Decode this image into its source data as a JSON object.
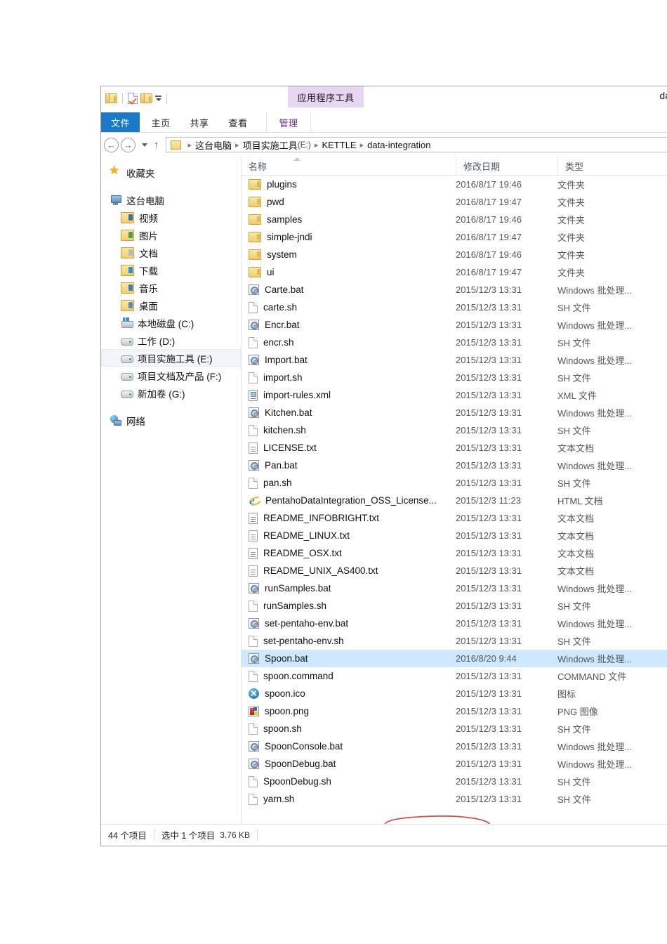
{
  "window": {
    "title": "da",
    "contextual_tab_header": "应用程序工具"
  },
  "quick_access": {
    "folder_icon": "folder-icon",
    "properties_icon": "page-check-icon",
    "new_folder_icon": "new-folder-icon",
    "customize_icon": "chevron-down-icon"
  },
  "ribbon": {
    "tabs": [
      {
        "id": "file",
        "label": "文件"
      },
      {
        "id": "home",
        "label": "主页"
      },
      {
        "id": "share",
        "label": "共享"
      },
      {
        "id": "view",
        "label": "查看"
      },
      {
        "id": "manage",
        "label": "管理"
      }
    ],
    "active_tab": "文件",
    "accent_color": "#1a7ac7",
    "contextual_color": "#e6d6f1"
  },
  "addressbar": {
    "back_icon": "back-arrow-icon",
    "forward_icon": "forward-arrow-icon",
    "history_icon": "chevron-down-icon",
    "up_icon": "up-arrow-icon",
    "crumbs": [
      {
        "label": "这台电脑",
        "drive": ""
      },
      {
        "label": "项目实施工具",
        "drive": "(E:)"
      },
      {
        "label": "KETTLE",
        "drive": ""
      },
      {
        "label": "data-integration",
        "drive": ""
      }
    ]
  },
  "navpane": {
    "items": [
      {
        "label": "收藏夹",
        "icon": "star-icon",
        "indent": false,
        "group": 0
      },
      {
        "label": "这台电脑",
        "icon": "computer-icon",
        "indent": false,
        "group": 1
      },
      {
        "label": "视频",
        "icon": "videos-folder-icon",
        "indent": true,
        "group": 1
      },
      {
        "label": "图片",
        "icon": "pictures-folder-icon",
        "indent": true,
        "group": 1
      },
      {
        "label": "文档",
        "icon": "documents-folder-icon",
        "indent": true,
        "group": 1
      },
      {
        "label": "下载",
        "icon": "downloads-folder-icon",
        "indent": true,
        "group": 1
      },
      {
        "label": "音乐",
        "icon": "music-folder-icon",
        "indent": true,
        "group": 1
      },
      {
        "label": "桌面",
        "icon": "desktop-folder-icon",
        "indent": true,
        "group": 1
      },
      {
        "label": "本地磁盘 (C:)",
        "icon": "system-drive-icon",
        "indent": true,
        "group": 1
      },
      {
        "label": "工作 (D:)",
        "icon": "drive-icon",
        "indent": true,
        "group": 1
      },
      {
        "label": "项目实施工具 (E:)",
        "icon": "drive-icon",
        "indent": true,
        "group": 1,
        "selected": true
      },
      {
        "label": "项目文档及产品 (F:)",
        "icon": "drive-icon",
        "indent": true,
        "group": 1
      },
      {
        "label": "新加卷 (G:)",
        "icon": "drive-icon",
        "indent": true,
        "group": 1
      },
      {
        "label": "网络",
        "icon": "network-icon",
        "indent": false,
        "group": 2
      }
    ],
    "selected_bg": "#f2f6fb"
  },
  "filelist": {
    "columns": [
      {
        "key": "name",
        "label": "名称",
        "sorted": "asc"
      },
      {
        "key": "date",
        "label": "修改日期"
      },
      {
        "key": "type",
        "label": "类型"
      }
    ],
    "selected_row_color": "#cde8ff",
    "rows": [
      {
        "name": "plugins",
        "date": "2016/8/17 19:46",
        "type": "文件夹",
        "icon": "folder-icon"
      },
      {
        "name": "pwd",
        "date": "2016/8/17 19:47",
        "type": "文件夹",
        "icon": "folder-icon"
      },
      {
        "name": "samples",
        "date": "2016/8/17 19:46",
        "type": "文件夹",
        "icon": "folder-icon"
      },
      {
        "name": "simple-jndi",
        "date": "2016/8/17 19:47",
        "type": "文件夹",
        "icon": "folder-icon"
      },
      {
        "name": "system",
        "date": "2016/8/17 19:46",
        "type": "文件夹",
        "icon": "folder-icon"
      },
      {
        "name": "ui",
        "date": "2016/8/17 19:47",
        "type": "文件夹",
        "icon": "folder-icon"
      },
      {
        "name": "Carte.bat",
        "date": "2015/12/3 13:31",
        "type": "Windows 批处理...",
        "icon": "bat-file-icon"
      },
      {
        "name": "carte.sh",
        "date": "2015/12/3 13:31",
        "type": "SH 文件",
        "icon": "blank-file-icon"
      },
      {
        "name": "Encr.bat",
        "date": "2015/12/3 13:31",
        "type": "Windows 批处理...",
        "icon": "bat-file-icon"
      },
      {
        "name": "encr.sh",
        "date": "2015/12/3 13:31",
        "type": "SH 文件",
        "icon": "blank-file-icon"
      },
      {
        "name": "Import.bat",
        "date": "2015/12/3 13:31",
        "type": "Windows 批处理...",
        "icon": "bat-file-icon"
      },
      {
        "name": "import.sh",
        "date": "2015/12/3 13:31",
        "type": "SH 文件",
        "icon": "blank-file-icon"
      },
      {
        "name": "import-rules.xml",
        "date": "2015/12/3 13:31",
        "type": "XML 文件",
        "icon": "xml-file-icon"
      },
      {
        "name": "Kitchen.bat",
        "date": "2015/12/3 13:31",
        "type": "Windows 批处理...",
        "icon": "bat-file-icon"
      },
      {
        "name": "kitchen.sh",
        "date": "2015/12/3 13:31",
        "type": "SH 文件",
        "icon": "blank-file-icon"
      },
      {
        "name": "LICENSE.txt",
        "date": "2015/12/3 13:31",
        "type": "文本文档",
        "icon": "text-file-icon"
      },
      {
        "name": "Pan.bat",
        "date": "2015/12/3 13:31",
        "type": "Windows 批处理...",
        "icon": "bat-file-icon"
      },
      {
        "name": "pan.sh",
        "date": "2015/12/3 13:31",
        "type": "SH 文件",
        "icon": "blank-file-icon"
      },
      {
        "name": "PentahoDataIntegration_OSS_License...",
        "date": "2015/12/3 11:23",
        "type": "HTML 文档",
        "icon": "html-file-icon"
      },
      {
        "name": "README_INFOBRIGHT.txt",
        "date": "2015/12/3 13:31",
        "type": "文本文档",
        "icon": "text-file-icon"
      },
      {
        "name": "README_LINUX.txt",
        "date": "2015/12/3 13:31",
        "type": "文本文档",
        "icon": "text-file-icon"
      },
      {
        "name": "README_OSX.txt",
        "date": "2015/12/3 13:31",
        "type": "文本文档",
        "icon": "text-file-icon"
      },
      {
        "name": "README_UNIX_AS400.txt",
        "date": "2015/12/3 13:31",
        "type": "文本文档",
        "icon": "text-file-icon"
      },
      {
        "name": "runSamples.bat",
        "date": "2015/12/3 13:31",
        "type": "Windows 批处理...",
        "icon": "bat-file-icon"
      },
      {
        "name": "runSamples.sh",
        "date": "2015/12/3 13:31",
        "type": "SH 文件",
        "icon": "blank-file-icon"
      },
      {
        "name": "set-pentaho-env.bat",
        "date": "2015/12/3 13:31",
        "type": "Windows 批处理...",
        "icon": "bat-file-icon"
      },
      {
        "name": "set-pentaho-env.sh",
        "date": "2015/12/3 13:31",
        "type": "SH 文件",
        "icon": "blank-file-icon"
      },
      {
        "name": "Spoon.bat",
        "date": "2016/8/20 9:44",
        "type": "Windows 批处理...",
        "icon": "bat-file-icon",
        "selected": true
      },
      {
        "name": "spoon.command",
        "date": "2015/12/3 13:31",
        "type": "COMMAND 文件",
        "icon": "blank-file-icon"
      },
      {
        "name": "spoon.ico",
        "date": "2015/12/3 13:31",
        "type": "图标",
        "icon": "ico-file-icon"
      },
      {
        "name": "spoon.png",
        "date": "2015/12/3 13:31",
        "type": "PNG 图像",
        "icon": "png-file-icon"
      },
      {
        "name": "spoon.sh",
        "date": "2015/12/3 13:31",
        "type": "SH 文件",
        "icon": "blank-file-icon"
      },
      {
        "name": "SpoonConsole.bat",
        "date": "2015/12/3 13:31",
        "type": "Windows 批处理...",
        "icon": "bat-file-icon"
      },
      {
        "name": "SpoonDebug.bat",
        "date": "2015/12/3 13:31",
        "type": "Windows 批处理...",
        "icon": "bat-file-icon"
      },
      {
        "name": "SpoonDebug.sh",
        "date": "2015/12/3 13:31",
        "type": "SH 文件",
        "icon": "blank-file-icon"
      },
      {
        "name": "yarn.sh",
        "date": "2015/12/3 13:31",
        "type": "SH 文件",
        "icon": "blank-file-icon"
      }
    ]
  },
  "statusbar": {
    "item_count": "44 个项目",
    "selection": "选中 1 个项目",
    "size": "3.76 KB"
  },
  "annotation": {
    "type": "hand-drawn-ellipse",
    "color": "#d94a52",
    "target": "Spoon.bat"
  }
}
